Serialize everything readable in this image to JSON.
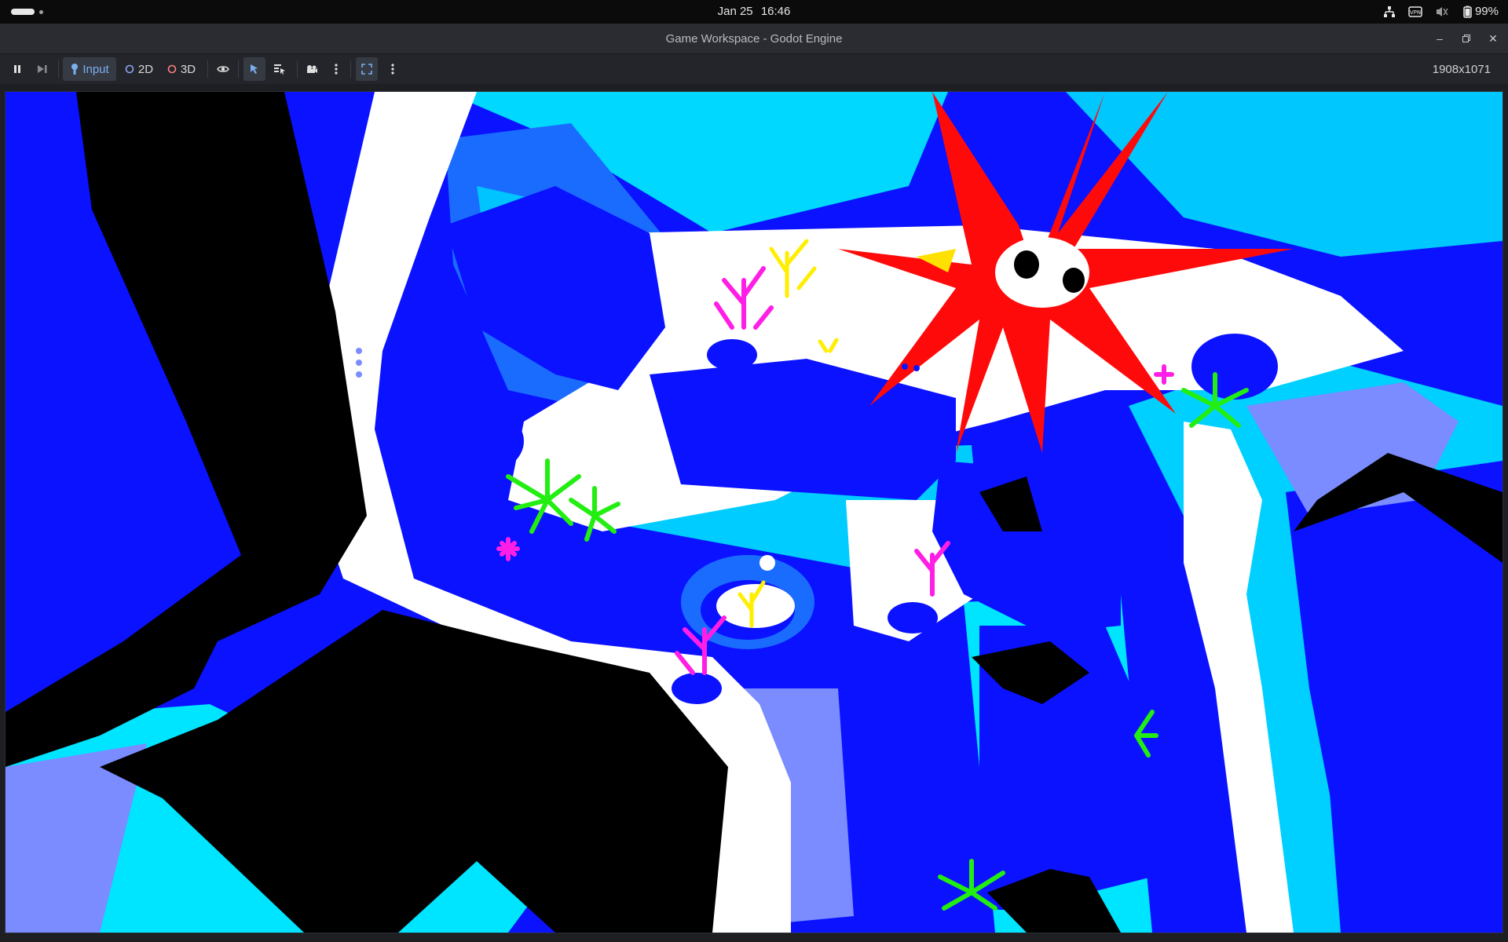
{
  "system_bar": {
    "date": "Jan 25",
    "time": "16:46",
    "battery": "99%",
    "icons": [
      "network-icon",
      "vpn-icon",
      "volume-muted-icon",
      "battery-icon"
    ]
  },
  "window": {
    "title": "Game Workspace - Godot Engine",
    "controls": [
      "minimize-icon",
      "restore-icon",
      "close-icon"
    ]
  },
  "toolbar": {
    "input_label": "Input",
    "mode_2d_label": "2D",
    "mode_3d_label": "3D",
    "resolution": "1908x1071",
    "icons": [
      "pause-icon",
      "step-frame-icon",
      "input-icon",
      "eye-icon",
      "select-pointer-icon",
      "list-select-icon",
      "camera-icon",
      "more-options-icon",
      "fullscreen-icon",
      "more-options-icon"
    ]
  },
  "colors": {
    "accent_blue": "#7ab0f0",
    "game_blue": "#0a12ff",
    "game_cyan": "#00e5ff",
    "game_red": "#ff0a0a",
    "coral_magenta": "#ff1ee6",
    "anemone_green": "#22ee11"
  }
}
